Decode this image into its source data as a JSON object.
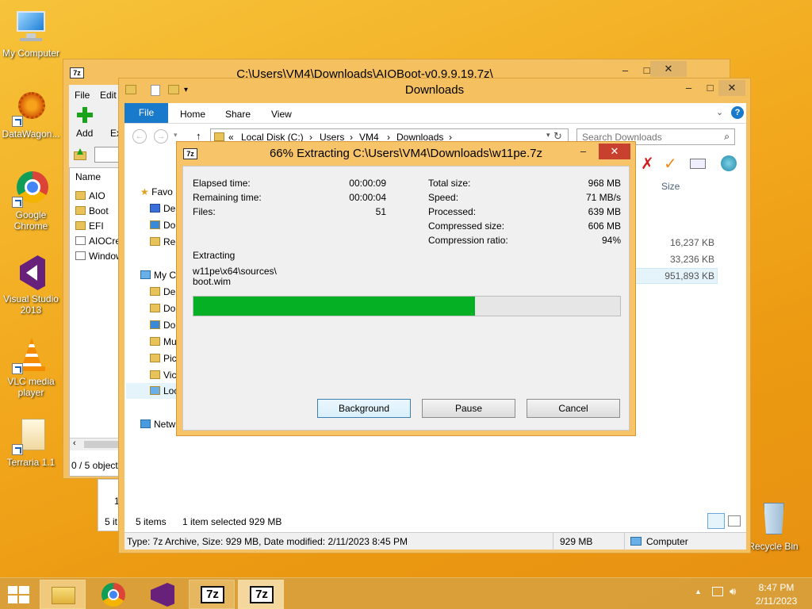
{
  "desktop": {
    "icons": [
      {
        "label": "My Computer",
        "icon": "computer-icon"
      },
      {
        "label": "DataWagon...",
        "icon": "datawagon-icon"
      },
      {
        "label": "Google Chrome",
        "icon": "chrome-icon"
      },
      {
        "label": "Visual Studio 2013",
        "icon": "visual-studio-icon"
      },
      {
        "label": "VLC media player",
        "icon": "vlc-icon"
      },
      {
        "label": "Terraria 1.1",
        "icon": "terraria-icon"
      }
    ],
    "recycle_bin": "Recycle Bin"
  },
  "sevenzip_window": {
    "app_icon": "7z",
    "title": "C:\\Users\\VM4\\Downloads\\AIOBoot-v0.9.9.19.7z\\",
    "menu": [
      "File",
      "Edit"
    ],
    "toolbar": {
      "add": "Add",
      "extract": "Extr"
    },
    "list_header": "Name",
    "files": [
      "AIO",
      "Boot",
      "EFI",
      "AIOCre",
      "Window"
    ],
    "status": "0 / 5 object"
  },
  "explorer_window": {
    "title": "Downloads",
    "tabs": [
      "File",
      "Home",
      "Share",
      "View"
    ],
    "address": {
      "parts": [
        "Local Disk (C:)",
        "Users",
        "VM4",
        "Downloads"
      ],
      "prefix": "«"
    },
    "search_placeholder": "Search Downloads",
    "nav": {
      "favorites": "Favo",
      "fav_items": [
        "De",
        "Do",
        "Rec"
      ],
      "computer": "My C",
      "computer_items": [
        "De",
        "Do",
        "Do",
        "Mu",
        "Pic",
        "Vic",
        "Loc"
      ],
      "network": "Netw"
    },
    "size_header": "Size",
    "sizes": [
      "16,237 KB",
      "33,236 KB",
      "951,893 KB"
    ],
    "status_items": "5 items",
    "status_selected": "1 item selected  929 MB",
    "details": "Type: 7z Archive, Size: 929 MB, Date modified: 2/11/2023 8:45 PM",
    "details_size": "929 MB",
    "details_location": "Computer"
  },
  "behind_status": {
    "num": "1",
    "items": "5 it"
  },
  "extract_dialog": {
    "app_icon": "7z",
    "title": "66% Extracting C:\\Users\\VM4\\Downloads\\w11pe.7z",
    "left_stats": [
      {
        "label": "Elapsed time:",
        "value": "00:00:09"
      },
      {
        "label": "Remaining time:",
        "value": "00:00:04"
      },
      {
        "label": "Files:",
        "value": "51"
      }
    ],
    "right_stats": [
      {
        "label": "Total size:",
        "value": "968 MB"
      },
      {
        "label": "Speed:",
        "value": "71 MB/s"
      },
      {
        "label": "Processed:",
        "value": "639 MB"
      },
      {
        "label": "Compressed size:",
        "value": "606 MB"
      },
      {
        "label": "Compression ratio:",
        "value": "94%"
      }
    ],
    "action": "Extracting",
    "current_path": "w11pe\\x64\\sources\\",
    "current_file": "boot.wim",
    "progress": 0.66,
    "buttons": {
      "background": "Background",
      "pause": "Pause",
      "cancel": "Cancel"
    }
  },
  "taskbar": {
    "time": "8:47 PM",
    "date": "2/11/2023",
    "apps": [
      "file-explorer-icon",
      "chrome-icon",
      "visual-studio-icon",
      "7zip-icon",
      "7zip-icon"
    ]
  },
  "colors": {
    "progress": "#06b025",
    "accent": "#1979ca",
    "window_frame": "#f5c060"
  }
}
